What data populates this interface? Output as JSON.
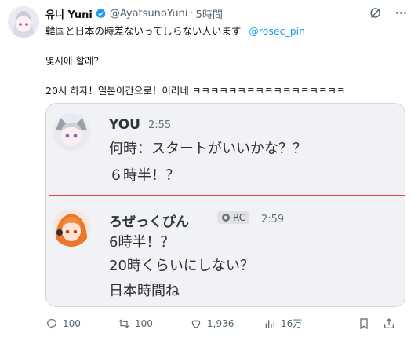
{
  "tweet": {
    "display_name": "유니 Yuni",
    "handle": "@AyatsunoYuni",
    "separator": "·",
    "time": "5時間",
    "line1": "韓国と日本の時差ないってしらない人います",
    "mention": "@rosec_pin",
    "line2": "몇시에 할레？",
    "line3": "20시 하자！일본이간으로！이러네 ㅋㅋㅋㅋㅋㅋㅋㅋㅋㅋㅋㅋㅋㅋㅋㅋㅋ"
  },
  "media": {
    "msg1": {
      "name": "YOU",
      "time": "2:55",
      "line1": "何時：スタートがいいかな？？",
      "line2": "６時半！？"
    },
    "msg2": {
      "name": "ろぜっくぴん",
      "badge": "RC",
      "time": "2:59",
      "line1": "6時半！？",
      "line2": "20時くらいにしない？",
      "line3": "日本時間ね"
    },
    "divider_color": "#e0464c"
  },
  "actions": {
    "replies": "100",
    "reposts": "100",
    "likes": "1,936",
    "views": "16万"
  },
  "colors": {
    "accent": "#1d9bf0",
    "secondary_text": "#536471",
    "verified_badge": "#1d9bf0"
  },
  "icons": [
    "verified-badge-icon",
    "grok-icon",
    "more-icon",
    "reply-icon",
    "repost-icon",
    "like-icon",
    "views-icon",
    "bookmark-icon",
    "share-icon"
  ]
}
